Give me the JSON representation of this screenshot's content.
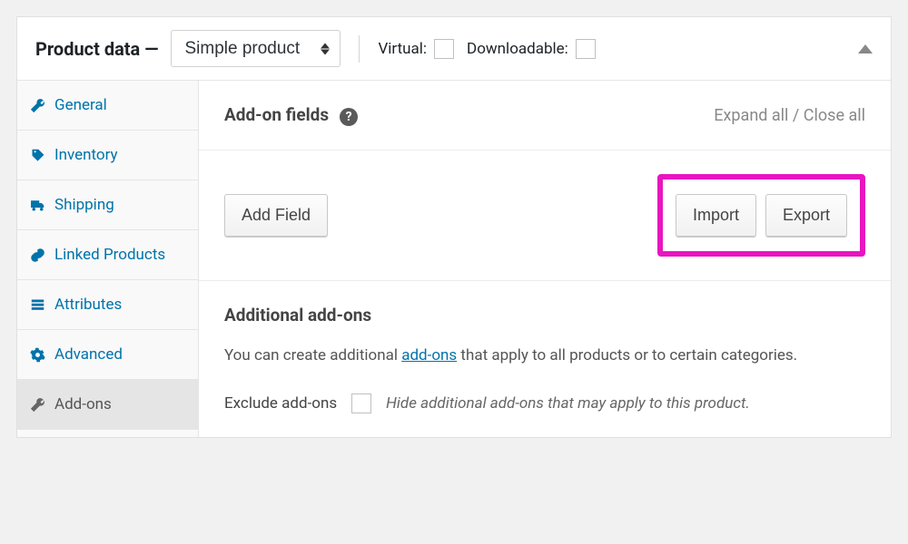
{
  "header": {
    "title": "Product data —",
    "product_type": "Simple product",
    "virtual_label": "Virtual:",
    "downloadable_label": "Downloadable:"
  },
  "tabs": {
    "general": "General",
    "inventory": "Inventory",
    "shipping": "Shipping",
    "linked": "Linked Products",
    "attributes": "Attributes",
    "advanced": "Advanced",
    "addons": "Add-ons"
  },
  "addons_panel": {
    "heading": "Add-on fields",
    "expand": "Expand all",
    "sep": " / ",
    "close": "Close all",
    "add_field_btn": "Add Field",
    "import_btn": "Import",
    "export_btn": "Export",
    "additional_heading": "Additional add-ons",
    "additional_desc_pre": "You can create additional ",
    "additional_link": "add-ons",
    "additional_desc_post": " that apply to all products or to certain categories.",
    "exclude_label": "Exclude add-ons",
    "exclude_help": "Hide additional add-ons that may apply to this product."
  }
}
